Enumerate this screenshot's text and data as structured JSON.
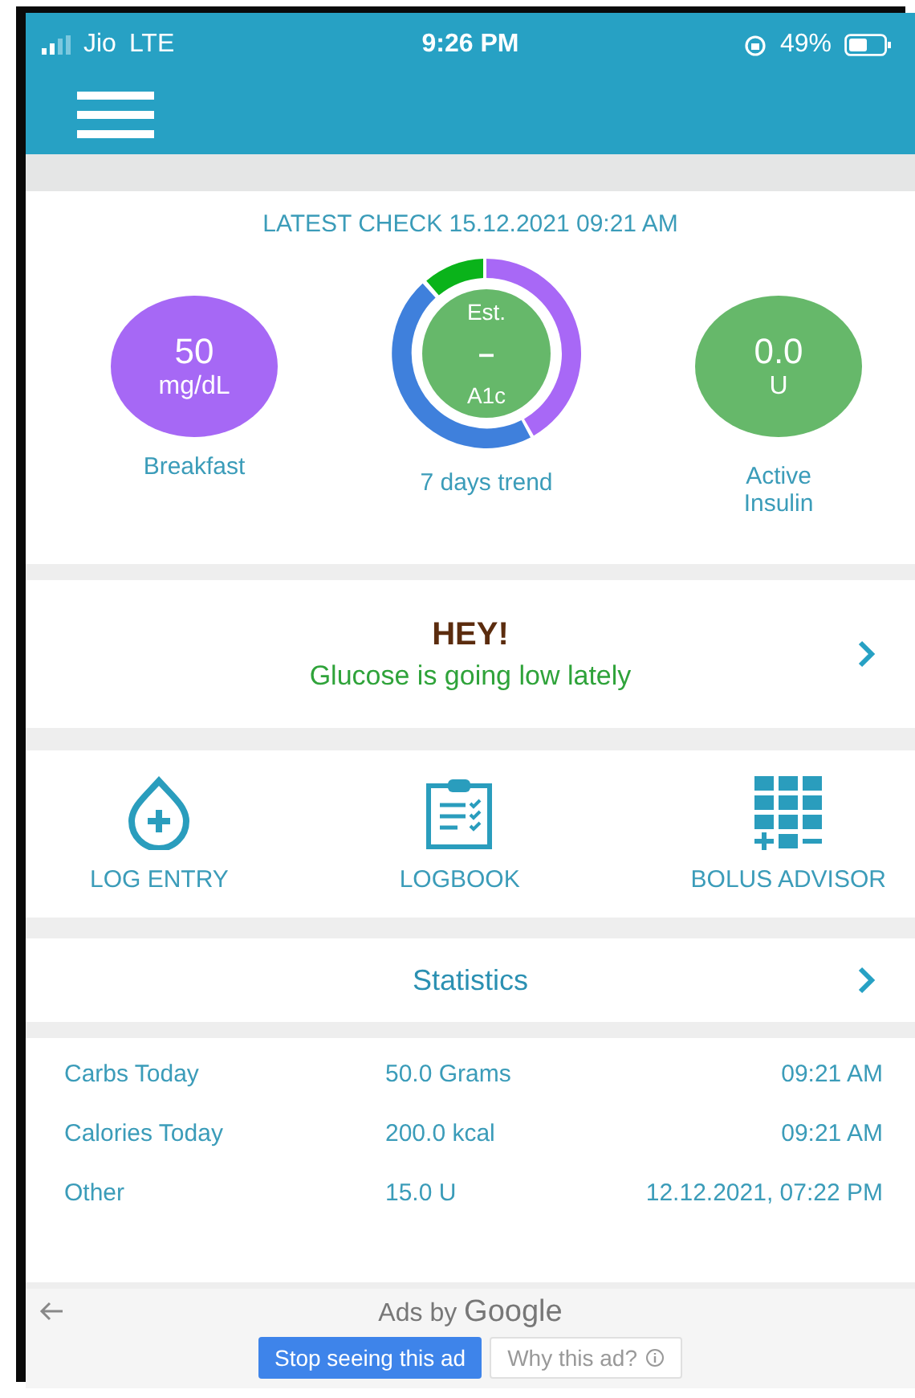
{
  "status_bar": {
    "carrier": "Jio",
    "network": "LTE",
    "time": "9:26 PM",
    "battery": "49%"
  },
  "latest_check": {
    "title": "LATEST CHECK 15.12.2021 09:21 AM",
    "reading": {
      "value": "50",
      "unit": "mg/dL",
      "label": "Breakfast"
    },
    "trend": {
      "top": "Est.",
      "middle": "–",
      "bottom": "A1c",
      "label": "7 days trend"
    },
    "insulin": {
      "value": "0.0",
      "unit": "U",
      "label": "Active Insulin"
    }
  },
  "alert": {
    "title": "HEY!",
    "message": "Glucose is going low lately"
  },
  "actions": [
    {
      "kind": "drop",
      "label": "LOG ENTRY"
    },
    {
      "kind": "clipboard",
      "label": "LOGBOOK"
    },
    {
      "kind": "grid",
      "label": "BOLUS ADVISOR"
    }
  ],
  "statistics": {
    "title": "Statistics",
    "rows": [
      {
        "name": "Carbs Today",
        "value": "50.0 Grams",
        "time": "09:21 AM"
      },
      {
        "name": "Calories Today",
        "value": "200.0 kcal",
        "time": "09:21 AM"
      },
      {
        "name": "Other",
        "value": "15.0 U",
        "time": "12.12.2021, 07:22 PM"
      }
    ]
  },
  "ad": {
    "title": "Ads by",
    "brand": "Google",
    "stop_button": "Stop seeing this ad",
    "why_button": "Why this ad?"
  }
}
